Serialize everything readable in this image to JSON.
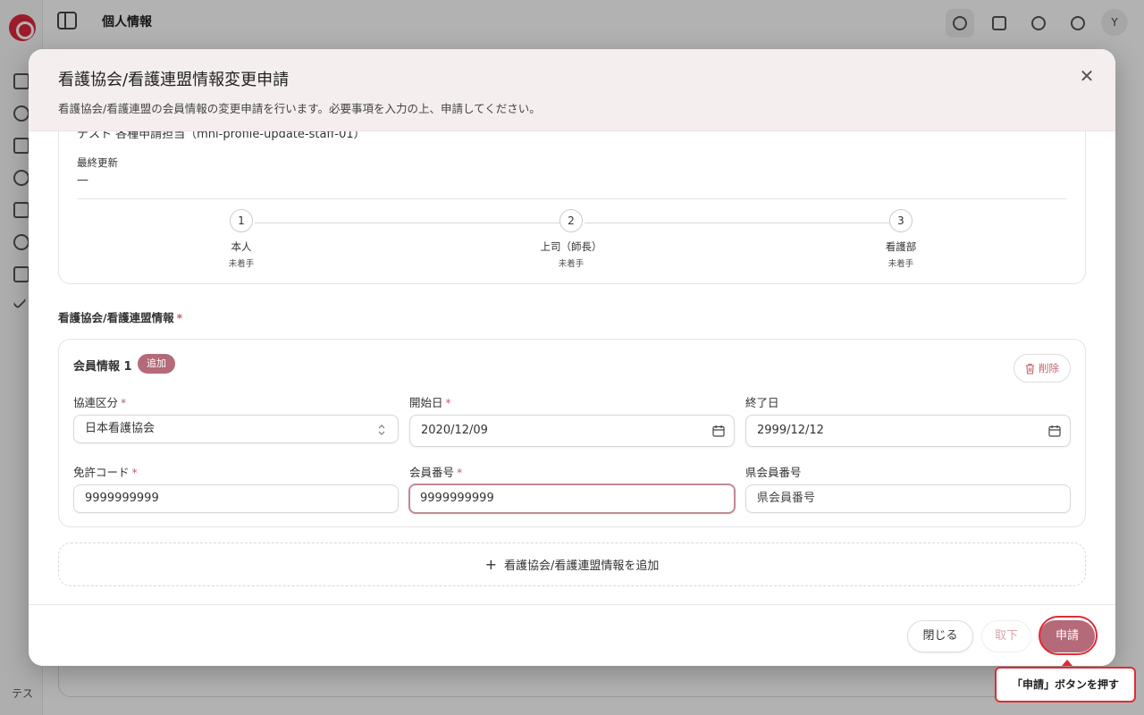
{
  "app": {
    "header_title": "個人情報",
    "user_initial": "Y",
    "sidebar_user": "テス"
  },
  "modal": {
    "title": "看護協会/看護連盟情報変更申請",
    "description": "看護協会/看護連盟の会員情報の変更申請を行います。必要事項を入力の上、申請してください。",
    "close_icon": "✕"
  },
  "summary": {
    "cut_text": "テスト 各種申請担当（mnl-profile-update-staff-01）",
    "last_updated_label": "最終更新",
    "last_updated_value": "—"
  },
  "steps": [
    {
      "num": "1",
      "name": "本人",
      "status": "未着手"
    },
    {
      "num": "2",
      "name": "上司（師長）",
      "status": "未着手"
    },
    {
      "num": "3",
      "name": "看護部",
      "status": "未着手"
    }
  ],
  "section": {
    "title": "看護協会/看護連盟情報",
    "required_mark": "*"
  },
  "member": {
    "title": "会員情報 1",
    "badge": "追加",
    "delete_label": "削除",
    "fields": {
      "category": {
        "label": "協連区分",
        "required": "*",
        "value": "日本看護協会"
      },
      "start_date": {
        "label": "開始日",
        "required": "*",
        "value": "2020/12/09"
      },
      "end_date": {
        "label": "終了日",
        "value": "2999/12/12"
      },
      "license_code": {
        "label": "免許コード",
        "required": "*",
        "value": "9999999999"
      },
      "member_number": {
        "label": "会員番号",
        "required": "*",
        "value": "9999999999"
      },
      "pref_member_number": {
        "label": "県会員番号",
        "placeholder": "県会員番号"
      }
    }
  },
  "add_button": {
    "plus": "+",
    "label": "看護協会/看護連盟情報を追加"
  },
  "footer": {
    "close": "閉じる",
    "withdraw": "取下",
    "apply": "申請"
  },
  "tooltip": "「申請」ボタンを押す",
  "colors": {
    "accent": "#b46a78",
    "required": "#c4606b",
    "highlight": "#e02b35",
    "header_bg": "#f5eeef"
  }
}
